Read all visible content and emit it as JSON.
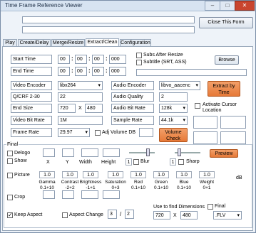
{
  "window": {
    "title": "Time Frame Reference Viewer",
    "min": "–",
    "max": "□",
    "close": "✕"
  },
  "top": {
    "close_button": "Close This Form"
  },
  "tabs": [
    "Play",
    "Create/Delay",
    "Merge/Resize",
    "Extract/Clean",
    "Configuration"
  ],
  "time": {
    "start_label": "Start Time",
    "end_label": "End Time",
    "start": {
      "h": "00",
      "m": "00",
      "s": "00",
      "ms": "000"
    },
    "end": {
      "h": "00",
      "m": "00",
      "s": "00",
      "ms": "000"
    },
    "subs_after_resize": "Subs After Resize",
    "subtitle_label": "Subtitle (SRT, ASS)",
    "browse": "Browse"
  },
  "video": {
    "encoder_label": "Video Encoder",
    "encoder": "libx264",
    "crf_label": "Q/CRF  2-30",
    "crf": "22",
    "end_size_label": "End Size",
    "width": "720",
    "x": "X",
    "height": "480",
    "bitrate_label": "Video Bit Rate",
    "bitrate": "1M",
    "framerate_label": "Frame Rate",
    "framerate": "29.97"
  },
  "audio": {
    "encoder_label": "Audio Encoder",
    "encoder": "libvo_aacenc",
    "quality_label": "Audio Quality",
    "quality": "2",
    "bitrate_label": "Audio Bit Rate",
    "bitrate": "128k",
    "samplerate_label": "Sample Rate",
    "samplerate": "44.1k",
    "adj_volume": "Adj Volume DB",
    "volume_check": "Volume Check",
    "extract_by_time": "Extract by Time",
    "activate_cursor": "Activate Cursor Location"
  },
  "final": {
    "group_label": "Final",
    "delogo": "Delogo",
    "show": "Show",
    "x": "X",
    "y": "Y",
    "width": "Width",
    "height": "Height",
    "one": "1",
    "blur": "Blur",
    "sharp": "Sharp",
    "preview": "Preview",
    "picture": "Picture",
    "adjust_values": [
      "1.0",
      "1.0",
      "1.0",
      "1.0",
      "1.0",
      "1.0",
      "1.0",
      "1.0"
    ],
    "adjust_labels": [
      "Gamma",
      "Contrast",
      "Brightness",
      "Saturation",
      "Red",
      "Green",
      "Blue",
      "Weight"
    ],
    "adjust_ranges": [
      "0.1+10",
      "-2+2",
      "-1+1",
      "0+3",
      "0.1+10",
      "0.1+10",
      "0.1+10",
      "0+1"
    ],
    "db": "dB",
    "crop": "Crop",
    "final_check": "Final",
    "keep_aspect": "Keep Aspect",
    "aspect_change": "Aspect Change",
    "aspect_w": "3",
    "aspect_sep": "/",
    "aspect_h": "2",
    "dims_label": "Use to find Dimensions",
    "dim_w": "720",
    "dim_x": "X",
    "dim_h": "480",
    "format": ".FLV"
  }
}
